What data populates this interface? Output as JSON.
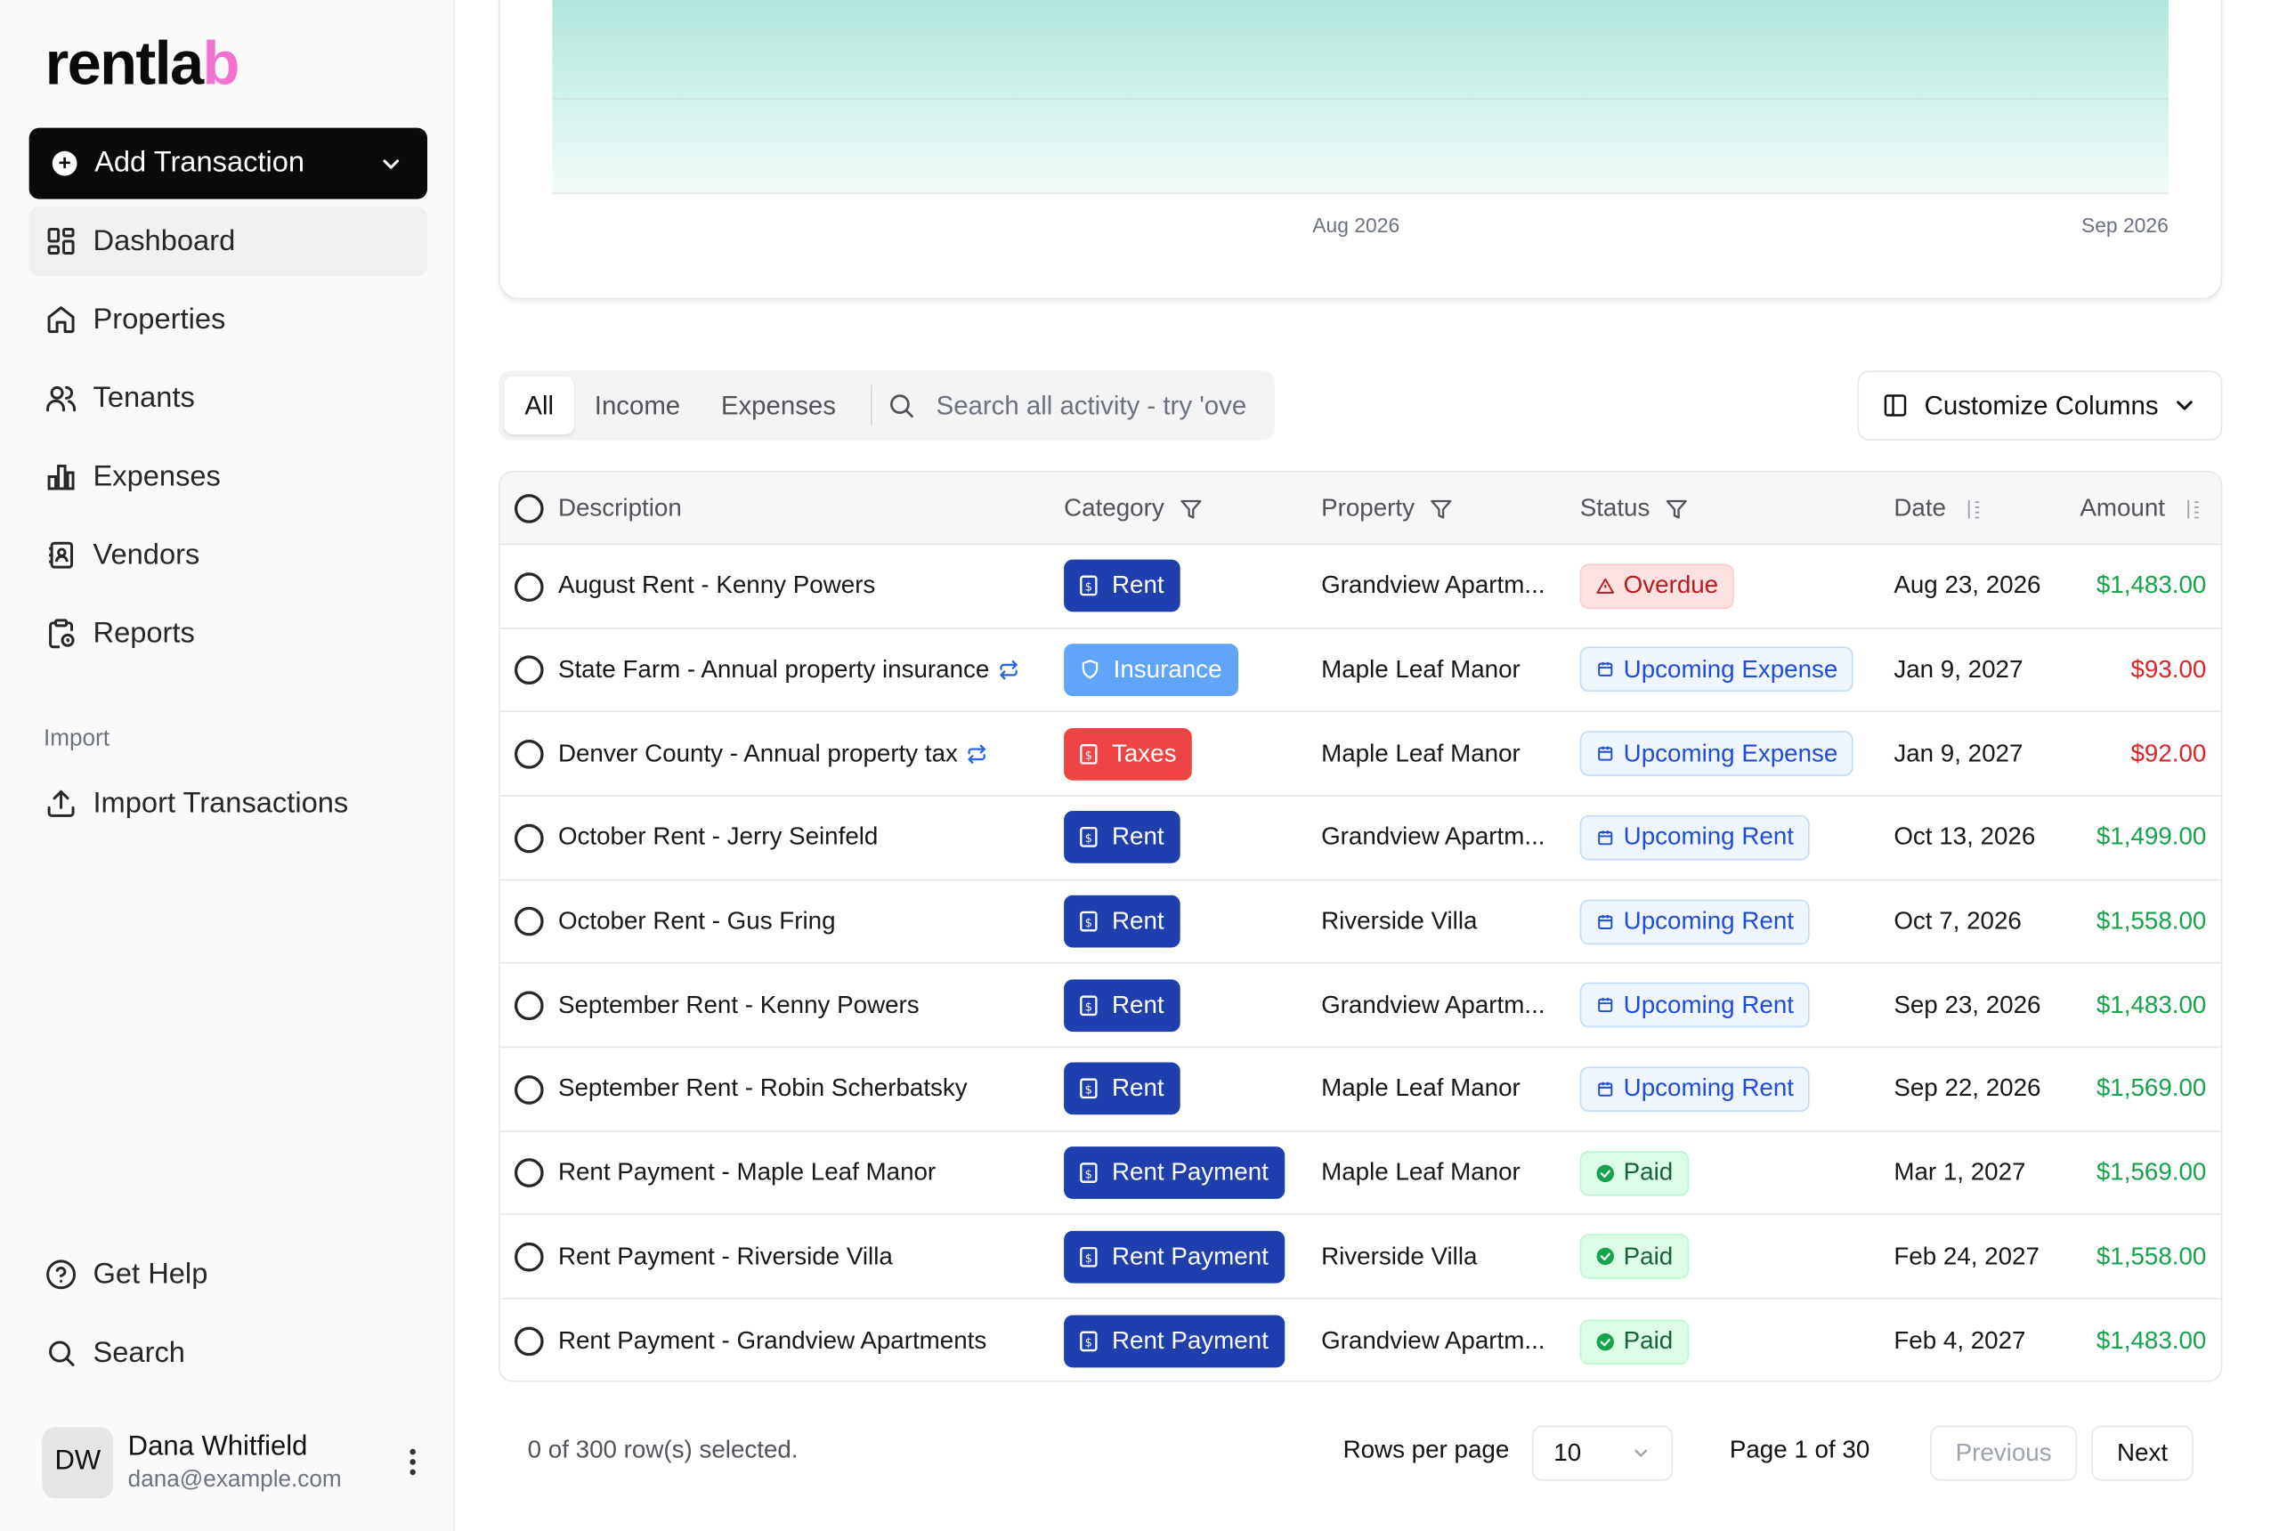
{
  "app": {
    "logo_main": "rentla",
    "logo_accent": "b"
  },
  "sidebar": {
    "add_label": "Add Transaction",
    "nav": [
      {
        "label": "Dashboard"
      },
      {
        "label": "Properties"
      },
      {
        "label": "Tenants"
      },
      {
        "label": "Expenses"
      },
      {
        "label": "Vendors"
      },
      {
        "label": "Reports"
      }
    ],
    "section_import": "Import",
    "import_label": "Import Transactions",
    "help_label": "Get Help",
    "search_label": "Search",
    "user": {
      "initials": "DW",
      "name": "Dana Whitfield",
      "email": "dana@example.com"
    }
  },
  "chart": {
    "x_ticks": [
      "Aug 2026",
      "Sep 2026"
    ],
    "fill_top_color": "#a7e3d8",
    "fill_bottom_color": "#f2fbf9"
  },
  "toolbar": {
    "tabs": [
      "All",
      "Income",
      "Expenses"
    ],
    "active_tab": "All",
    "search_placeholder": "Search all activity - try 'ove",
    "customize_label": "Customize Columns"
  },
  "table": {
    "columns": [
      "Description",
      "Category",
      "Property",
      "Status",
      "Date",
      "Amount"
    ],
    "rows": [
      {
        "description": "August Rent - Kenny Powers",
        "recurring": false,
        "category": "Rent",
        "cat_type": "rent",
        "property": "Grandview Apartm...",
        "status": "Overdue",
        "status_type": "overdue",
        "date": "Aug 23, 2026",
        "amount": "$1,483.00",
        "amount_type": "pos"
      },
      {
        "description": "State Farm - Annual property insurance",
        "recurring": true,
        "category": "Insurance",
        "cat_type": "ins",
        "property": "Maple Leaf Manor",
        "status": "Upcoming Expense",
        "status_type": "upcoming",
        "date": "Jan 9, 2027",
        "amount": "$93.00",
        "amount_type": "neg"
      },
      {
        "description": "Denver County - Annual property tax",
        "recurring": true,
        "category": "Taxes",
        "cat_type": "tax",
        "property": "Maple Leaf Manor",
        "status": "Upcoming Expense",
        "status_type": "upcoming",
        "date": "Jan 9, 2027",
        "amount": "$92.00",
        "amount_type": "neg"
      },
      {
        "description": "October Rent - Jerry Seinfeld",
        "recurring": false,
        "category": "Rent",
        "cat_type": "rent",
        "property": "Grandview Apartm...",
        "status": "Upcoming Rent",
        "status_type": "upcoming",
        "date": "Oct 13, 2026",
        "amount": "$1,499.00",
        "amount_type": "pos"
      },
      {
        "description": "October Rent - Gus Fring",
        "recurring": false,
        "category": "Rent",
        "cat_type": "rent",
        "property": "Riverside Villa",
        "status": "Upcoming Rent",
        "status_type": "upcoming",
        "date": "Oct 7, 2026",
        "amount": "$1,558.00",
        "amount_type": "pos"
      },
      {
        "description": "September Rent - Kenny Powers",
        "recurring": false,
        "category": "Rent",
        "cat_type": "rent",
        "property": "Grandview Apartm...",
        "status": "Upcoming Rent",
        "status_type": "upcoming",
        "date": "Sep 23, 2026",
        "amount": "$1,483.00",
        "amount_type": "pos"
      },
      {
        "description": "September Rent - Robin Scherbatsky",
        "recurring": false,
        "category": "Rent",
        "cat_type": "rent",
        "property": "Maple Leaf Manor",
        "status": "Upcoming Rent",
        "status_type": "upcoming",
        "date": "Sep 22, 2026",
        "amount": "$1,569.00",
        "amount_type": "pos"
      },
      {
        "description": "Rent Payment - Maple Leaf Manor",
        "recurring": false,
        "category": "Rent Payment",
        "cat_type": "rentpay",
        "property": "Maple Leaf Manor",
        "status": "Paid",
        "status_type": "paid",
        "date": "Mar 1, 2027",
        "amount": "$1,569.00",
        "amount_type": "pos"
      },
      {
        "description": "Rent Payment - Riverside Villa",
        "recurring": false,
        "category": "Rent Payment",
        "cat_type": "rentpay",
        "property": "Riverside Villa",
        "status": "Paid",
        "status_type": "paid",
        "date": "Feb 24, 2027",
        "amount": "$1,558.00",
        "amount_type": "pos"
      },
      {
        "description": "Rent Payment - Grandview Apartments",
        "recurring": false,
        "category": "Rent Payment",
        "cat_type": "rentpay",
        "property": "Grandview Apartm...",
        "status": "Paid",
        "status_type": "paid",
        "date": "Feb 4, 2027",
        "amount": "$1,483.00",
        "amount_type": "pos"
      }
    ]
  },
  "footer": {
    "selection": "0 of 300 row(s) selected.",
    "rows_per_page_label": "Rows per page",
    "rows_per_page": "10",
    "page_info": "Page 1 of 30",
    "prev_label": "Previous",
    "next_label": "Next"
  }
}
